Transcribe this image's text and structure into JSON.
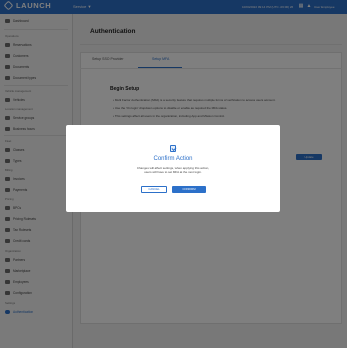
{
  "header": {
    "logo_text": "LAUNCH",
    "logo_subtitle": "",
    "service_label": "Service ▼",
    "datetime": "10/04/2022 09:14 PM (UTC -06:00) 26",
    "user_name": "User Employee"
  },
  "sidebar": {
    "top_item": "Dashboard",
    "sections": [
      {
        "title": "Operations",
        "items": [
          "Reservations",
          "Customers",
          "Documents",
          "Document types"
        ]
      },
      {
        "title": "Vehicle management",
        "items": [
          "Vehicles"
        ]
      },
      {
        "title": "Location management",
        "items": [
          "Service groups",
          "Business hours"
        ]
      },
      {
        "title": "Fleet",
        "items": [
          "Classes",
          "Types"
        ]
      },
      {
        "title": "Billing",
        "items": [
          "Invoices",
          "Payments"
        ]
      },
      {
        "title": "Pricing",
        "items": [
          "BPCs",
          "Pricing Rulesets",
          "Tax Rulesets",
          "Credit cards"
        ]
      },
      {
        "title": "Organization",
        "items": [
          "Partners",
          "Marketplace",
          "Employees",
          "Configuration"
        ]
      },
      {
        "title": "Settings",
        "items": [
          "Authentication"
        ]
      }
    ]
  },
  "main": {
    "page_title": "Authentication",
    "tabs": [
      "Setup SSO Provider",
      "Setup MFA"
    ],
    "active_tab": "Setup MFA",
    "section_title": "Begin Setup",
    "bullets": [
      "Multi Factor Authentication (MFA) is a security feature that requires multiple forms of verification to access users account.",
      "Use the 'On login' dropdown options to disable or enable as required the MFA status.",
      "This settings affect all users in the organization, including App and Mission Control."
    ],
    "update_label": "Update"
  },
  "modal": {
    "title": "Confirm Action",
    "body_line1": "Changes will affect settings, when applying this action,",
    "body_line2": "users will have to set MFA at the next login.",
    "cancel_label": "CANCEL",
    "confirm_label": "CONFIRM"
  },
  "colors": {
    "primary": "#2c70c9",
    "overlay": "rgba(0,0,0,0.5)"
  }
}
